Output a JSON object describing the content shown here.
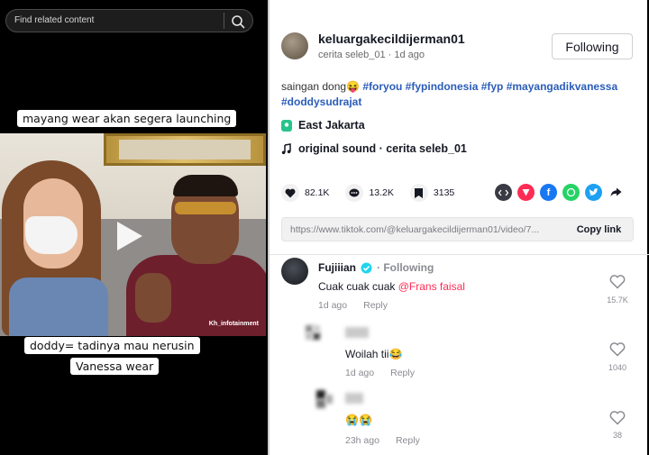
{
  "search": {
    "placeholder": "Find related content"
  },
  "video": {
    "caption_top": "mayang wear akan segera launching",
    "caption_bottom_1": "doddy= tadinya mau nerusin",
    "caption_bottom_2": "Vanessa wear",
    "watermark": "Kh_infotainment"
  },
  "post": {
    "username": "keluargakecildijerman01",
    "subline": "cerita seleb_01 · 1d ago",
    "follow_label": "Following",
    "description_text": "saingan dong😝 ",
    "hashtags_line1": "#foryou #fypindonesia #fyp #mayangadikvanessa",
    "hashtags_line2": "#doddysudrajat",
    "location": "East Jakarta",
    "sound": "original sound · cerita seleb_01",
    "likes": "82.1K",
    "comments": "13.2K",
    "saves": "3135",
    "link_url": "https://www.tiktok.com/@keluargakecildijerman01/video/7...",
    "copy_link_label": "Copy link"
  },
  "comments": [
    {
      "name": "Fujiiian",
      "following_label": "· Following",
      "text": "Cuak cuak cuak ",
      "mention": "@Frans faisal",
      "time": "1d ago",
      "reply": "Reply",
      "likes": "15.7K"
    },
    {
      "text": "Woilah tii😂",
      "time": "1d ago",
      "reply": "Reply",
      "likes": "1040"
    },
    {
      "text": "😭😭",
      "time": "23h ago",
      "reply": "Reply",
      "likes": "38"
    }
  ],
  "colors": {
    "accent": "#fe2c55",
    "hashtag": "#2b5db8",
    "verified": "#20d5ec"
  }
}
